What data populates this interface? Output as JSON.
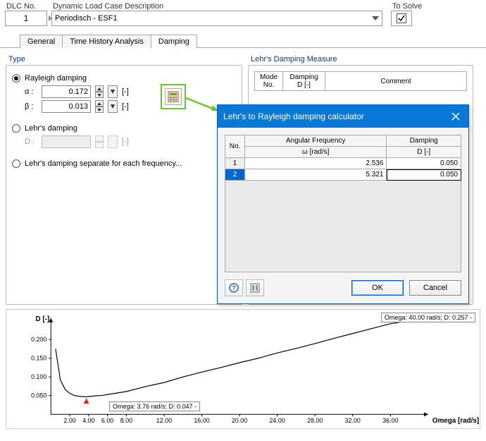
{
  "top": {
    "dlc_label": "DLC No.",
    "dlc_value": "1",
    "desc_label": "Dynamic Load Case Description",
    "desc_value": "Periodisch - ESF1",
    "to_solve_label": "To Solve",
    "to_solve_checked": true
  },
  "tabs": {
    "general": "General",
    "tha": "Time History Analysis",
    "damping": "Damping"
  },
  "panels": {
    "type_title": "Type",
    "lehr_title": "Lehr's Damping Measure"
  },
  "type": {
    "rayleigh_label": "Rayleigh damping",
    "alpha_label": "α :",
    "alpha_value": "0.172",
    "beta_label": "β :",
    "beta_value": "0.013",
    "unit": "[-]",
    "lehr_damping_label": "Lehr's damping",
    "d_label": "D :",
    "d_value": "",
    "lehr_sep_label": "Lehr's damping separate for each frequency..."
  },
  "lehr_table": {
    "h1a": "Mode",
    "h1b": "No.",
    "h2a": "Damping",
    "h2b": "D [-]",
    "h3": "Comment"
  },
  "dialog": {
    "title": "Lehr's to Rayleigh damping calculator",
    "h_no": "No.",
    "h_af1": "Angular Frequency",
    "h_af2": "ω [rad/s]",
    "h_d1": "Damping",
    "h_d2": "D [-]",
    "rows": [
      {
        "no": "1",
        "af": "2.536",
        "d": "0.050"
      },
      {
        "no": "2",
        "af": "5.321",
        "d": "0.050"
      }
    ],
    "ok": "OK",
    "cancel": "Cancel"
  },
  "chart_data": {
    "type": "line",
    "xlabel": "Omega [rad/s]",
    "ylabel": "D [-]",
    "xlim": [
      0,
      40
    ],
    "ylim": [
      0,
      0.257
    ],
    "xticks": [
      "2.00",
      "4.00",
      "6.00",
      "8.00",
      "12.00",
      "16.00",
      "20.00",
      "24.00",
      "28.00",
      "32.00",
      "36.00"
    ],
    "yticks": [
      "0.050",
      "0.100",
      "0.150",
      "0.200"
    ],
    "annotations": [
      {
        "text": "Omega: 40.00 rad/s; D: 0.257 -",
        "pos": "top-right"
      },
      {
        "text": "Omega: 3.76 rad/s; D: 0.047 -",
        "pos": "near-min"
      }
    ],
    "series": [
      {
        "name": "D",
        "x": [
          0.5,
          1,
          1.5,
          2,
          2.536,
          3,
          3.76,
          5,
          5.321,
          6,
          8,
          10,
          12,
          14,
          16,
          18,
          20,
          22,
          24,
          26,
          28,
          30,
          32,
          34,
          36,
          38,
          40
        ],
        "y": [
          0.175,
          0.092,
          0.067,
          0.056,
          0.05,
          0.048,
          0.047,
          0.05,
          0.05,
          0.053,
          0.061,
          0.074,
          0.085,
          0.1,
          0.113,
          0.125,
          0.138,
          0.15,
          0.164,
          0.176,
          0.189,
          0.203,
          0.216,
          0.229,
          0.242,
          0.25,
          0.257
        ]
      }
    ]
  }
}
